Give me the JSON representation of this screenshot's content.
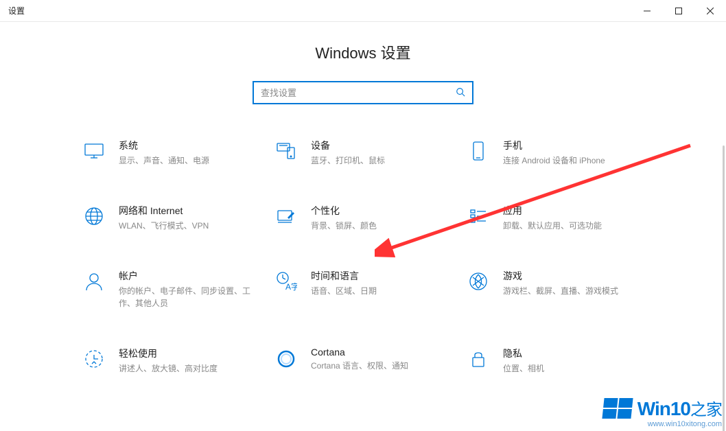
{
  "window": {
    "title": "设置"
  },
  "page_title": "Windows 设置",
  "search": {
    "placeholder": "查找设置",
    "value": ""
  },
  "tiles": [
    {
      "icon": "monitor-icon",
      "title": "系统",
      "desc": "显示、声音、通知、电源"
    },
    {
      "icon": "devices-icon",
      "title": "设备",
      "desc": "蓝牙、打印机、鼠标"
    },
    {
      "icon": "phone-icon",
      "title": "手机",
      "desc": "连接 Android 设备和 iPhone"
    },
    {
      "icon": "globe-icon",
      "title": "网络和 Internet",
      "desc": "WLAN、飞行模式、VPN"
    },
    {
      "icon": "personalize-icon",
      "title": "个性化",
      "desc": "背景、锁屏、颜色"
    },
    {
      "icon": "apps-icon",
      "title": "应用",
      "desc": "卸载、默认应用、可选功能"
    },
    {
      "icon": "account-icon",
      "title": "帐户",
      "desc": "你的帐户、电子邮件、同步设置、工作、其他人员"
    },
    {
      "icon": "timelang-icon",
      "title": "时间和语言",
      "desc": "语音、区域、日期"
    },
    {
      "icon": "gaming-icon",
      "title": "游戏",
      "desc": "游戏栏、截屏、直播、游戏模式"
    },
    {
      "icon": "ease-icon",
      "title": "轻松使用",
      "desc": "讲述人、放大镜、高对比度"
    },
    {
      "icon": "cortana-icon",
      "title": "Cortana",
      "desc": "Cortana 语言、权限、通知"
    },
    {
      "icon": "privacy-icon",
      "title": "隐私",
      "desc": "位置、相机"
    }
  ],
  "accent_color": "#0078d7",
  "arrow_color": "#ff3333",
  "watermark": {
    "text_en": "Win10",
    "text_zh": "之家",
    "url": "www.win10xitong.com"
  }
}
